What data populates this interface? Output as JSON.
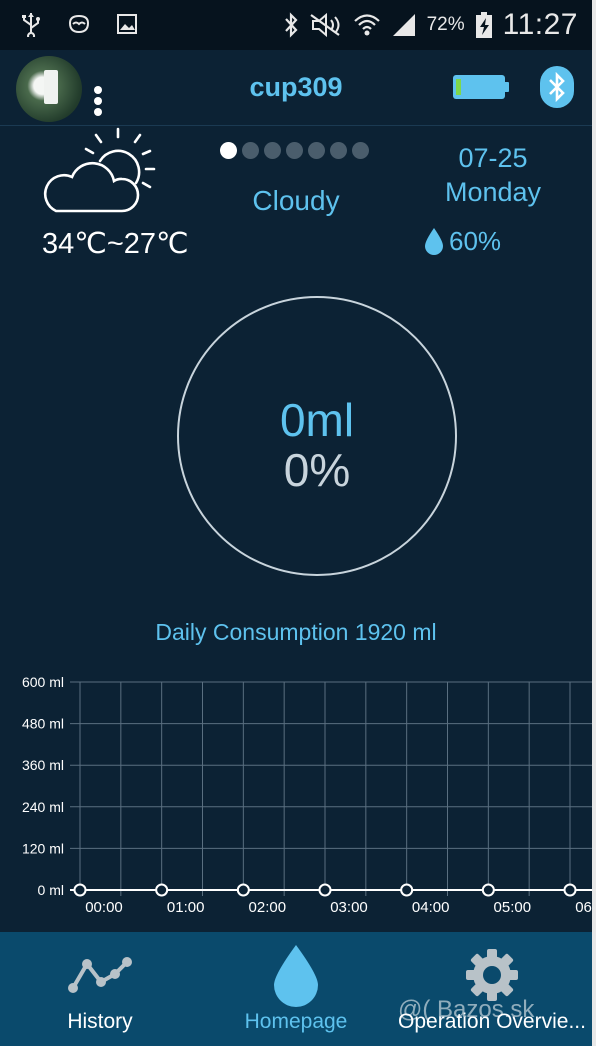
{
  "status_bar": {
    "battery_percent": "72%",
    "time": "11:27",
    "icons_left": [
      "usb-icon",
      "cat-notification-icon",
      "gallery-icon"
    ],
    "icons_right": [
      "bluetooth-icon",
      "mute-icon",
      "wifi-icon",
      "signal-icon",
      "battery-charging-icon"
    ]
  },
  "header": {
    "device_name": "cup309",
    "battery_level_fraction": 0.05,
    "colors": {
      "accent": "#5ec2ee",
      "battery_level": "#7ed84a"
    }
  },
  "weather": {
    "icon": "cloud-sun-icon",
    "temp_range": "34℃~27℃",
    "condition": "Cloudy",
    "date": "07-25",
    "day": "Monday",
    "humidity": "60%",
    "pager": {
      "pages": 7,
      "active": 0
    }
  },
  "gauge": {
    "volume": "0ml",
    "percent": "0%"
  },
  "daily_consumption": "Daily Consumption 1920 ml",
  "chart_data": {
    "type": "line",
    "x": [
      "00:00",
      "00:30",
      "01:00",
      "01:30",
      "02:00",
      "02:30",
      "03:00",
      "03:30",
      "04:00",
      "04:30",
      "05:00",
      "05:30",
      "06:00"
    ],
    "x_tick_labels": [
      "00:00",
      "01:00",
      "02:00",
      "03:00",
      "04:00",
      "05:00",
      "06:00"
    ],
    "point_x": [
      "00:00",
      "01:00",
      "02:00",
      "03:00",
      "04:00",
      "05:00",
      "06:00"
    ],
    "values": [
      0,
      0,
      0,
      0,
      0,
      0,
      0
    ],
    "y_tick_labels": [
      "600 ml",
      "480 ml",
      "360 ml",
      "240 ml",
      "120 ml",
      "0 ml"
    ],
    "ylim": [
      0,
      600
    ],
    "grid": true,
    "title": "",
    "xlabel": "",
    "ylabel": ""
  },
  "bottom_nav": {
    "items": [
      {
        "label": "History",
        "icon": "line-chart-icon"
      },
      {
        "label": "Homepage",
        "icon": "water-drop-icon"
      },
      {
        "label": "Operation Overvie...",
        "icon": "gear-icon"
      }
    ]
  },
  "watermark": "@( Bazos.sk"
}
